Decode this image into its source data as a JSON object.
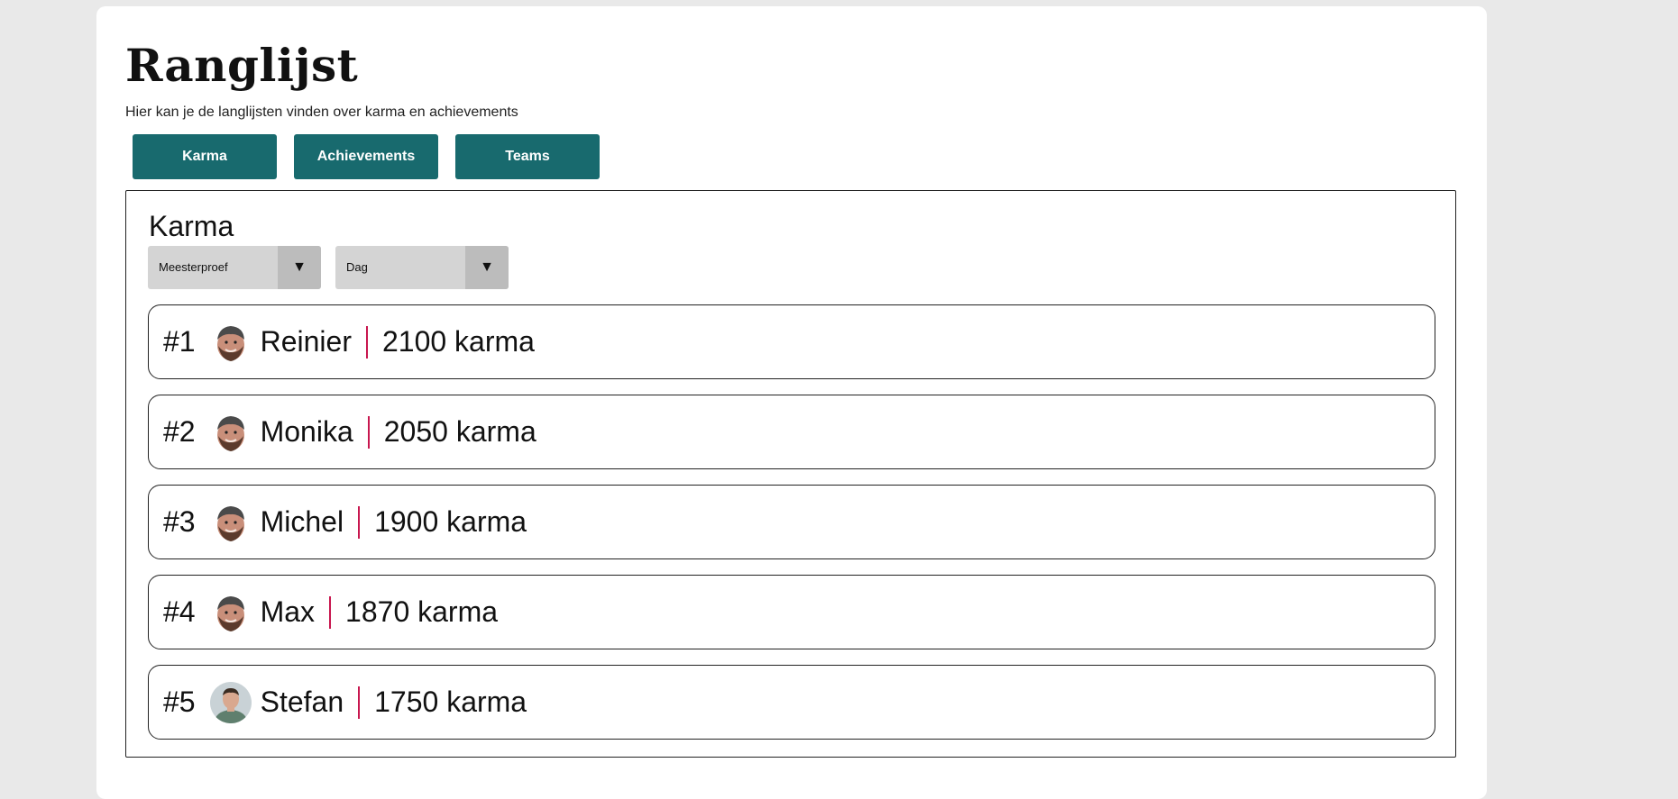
{
  "page": {
    "title": "Ranglijst",
    "subtitle": "Hier kan je de langlijsten vinden over karma en achievements"
  },
  "tabs": [
    {
      "label": "Karma"
    },
    {
      "label": "Achievements"
    },
    {
      "label": "Teams"
    }
  ],
  "panel": {
    "title": "Karma",
    "filters": {
      "group": {
        "value": "Meesterproef",
        "icon": "triangle-down-icon"
      },
      "period": {
        "value": "Dag",
        "icon": "triangle-down-icon"
      }
    }
  },
  "colors": {
    "accent": "#186a6e",
    "divider": "#c8174f",
    "select_bg": "#d4d4d4",
    "select_arrow_bg": "#bcbcbc"
  },
  "leaderboard": [
    {
      "rank": "#1",
      "name": "Reinier",
      "karma": "2100 karma",
      "avatar": "avatar-bearded-cap"
    },
    {
      "rank": "#2",
      "name": "Monika",
      "karma": "2050 karma",
      "avatar": "avatar-bearded-cap"
    },
    {
      "rank": "#3",
      "name": "Michel",
      "karma": "1900 karma",
      "avatar": "avatar-bearded-cap"
    },
    {
      "rank": "#4",
      "name": "Max",
      "karma": "1870 karma",
      "avatar": "avatar-bearded-cap"
    },
    {
      "rank": "#5",
      "name": "Stefan",
      "karma": "1750 karma",
      "avatar": "avatar-portrait"
    }
  ]
}
